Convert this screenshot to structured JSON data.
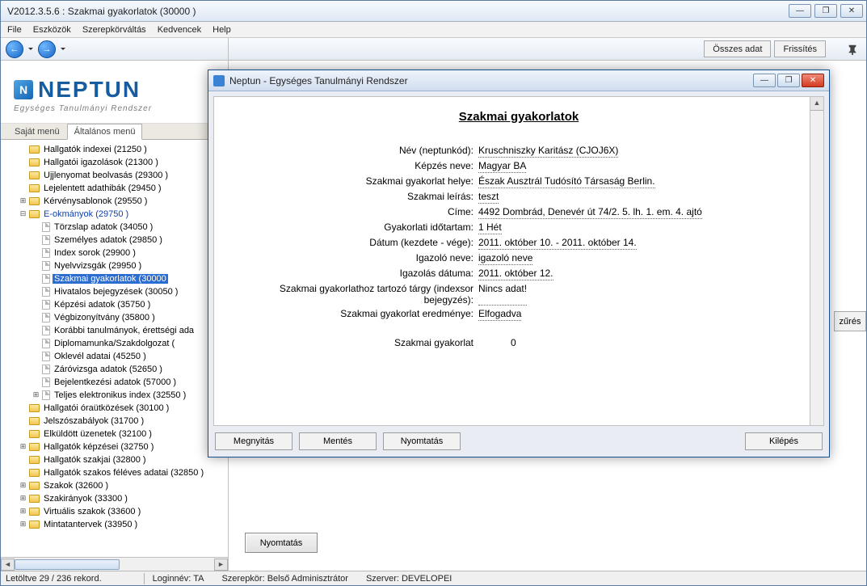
{
  "window": {
    "title": "V2012.3.5.6 : Szakmai gyakorlatok (30000  )"
  },
  "menu": {
    "file": "File",
    "tools": "Eszközök",
    "role": "Szerepkörváltás",
    "fav": "Kedvencek",
    "help": "Help"
  },
  "logo": {
    "name": "NEPTUN",
    "sub": "Egységes Tanulmányi Rendszer",
    "mark": "N"
  },
  "tabs": {
    "own": "Saját menü",
    "general": "Általános menü"
  },
  "toolbar": {
    "all": "Összes adat",
    "refresh": "Frissítés",
    "filter": "zűrés"
  },
  "tree": [
    {
      "d": 1,
      "exp": "",
      "ic": "folder",
      "txt": "Hallgatók indexei (21250  )"
    },
    {
      "d": 1,
      "exp": "",
      "ic": "folder",
      "txt": "Hallgatói igazolások (21300  )"
    },
    {
      "d": 1,
      "exp": "",
      "ic": "folder",
      "txt": "Ujjlenyomat beolvasás (29300  )"
    },
    {
      "d": 1,
      "exp": "",
      "ic": "folder",
      "txt": "Lejelentett adathibák (29450  )"
    },
    {
      "d": 1,
      "exp": "+",
      "ic": "folder",
      "txt": "Kérvénysablonok (29550  )"
    },
    {
      "d": 1,
      "exp": "-",
      "ic": "folder",
      "txt": "E-okmányok (29750  )",
      "cur": true
    },
    {
      "d": 2,
      "exp": "",
      "ic": "page",
      "txt": "Törzslap adatok (34050  )"
    },
    {
      "d": 2,
      "exp": "",
      "ic": "page",
      "txt": "Személyes adatok (29850  )"
    },
    {
      "d": 2,
      "exp": "",
      "ic": "page",
      "txt": "Index sorok (29900  )"
    },
    {
      "d": 2,
      "exp": "",
      "ic": "page",
      "txt": "Nyelvvizsgák (29950  )"
    },
    {
      "d": 2,
      "exp": "",
      "ic": "page",
      "txt": "Szakmai gyakorlatok (30000",
      "sel": true
    },
    {
      "d": 2,
      "exp": "",
      "ic": "page",
      "txt": "Hivatalos bejegyzések (30050  )"
    },
    {
      "d": 2,
      "exp": "",
      "ic": "page",
      "txt": "Képzési adatok (35750  )"
    },
    {
      "d": 2,
      "exp": "",
      "ic": "page",
      "txt": "Végbizonyítvány (35800  )"
    },
    {
      "d": 2,
      "exp": "",
      "ic": "page",
      "txt": "Korábbi tanulmányok, érettségi ada"
    },
    {
      "d": 2,
      "exp": "",
      "ic": "page",
      "txt": "Diplomamunka/Szakdolgozat ("
    },
    {
      "d": 2,
      "exp": "",
      "ic": "page",
      "txt": "Oklevél adatai (45250  )"
    },
    {
      "d": 2,
      "exp": "",
      "ic": "page",
      "txt": "Záróvizsga adatok (52650  )"
    },
    {
      "d": 2,
      "exp": "",
      "ic": "page",
      "txt": "Bejelentkezési adatok (57000  )"
    },
    {
      "d": 2,
      "exp": "+",
      "ic": "page",
      "txt": "Teljes elektronikus index (32550  )"
    },
    {
      "d": 1,
      "exp": "",
      "ic": "folder",
      "txt": "Hallgatói óraütközések (30100  )"
    },
    {
      "d": 1,
      "exp": "",
      "ic": "folder",
      "txt": "Jelszószabályok (31700  )"
    },
    {
      "d": 1,
      "exp": "",
      "ic": "folder",
      "txt": "Elküldött üzenetek (32100  )"
    },
    {
      "d": 1,
      "exp": "+",
      "ic": "folder",
      "txt": "Hallgatók képzései (32750  )"
    },
    {
      "d": 1,
      "exp": "",
      "ic": "folder",
      "txt": "Hallgatók szakjai (32800  )"
    },
    {
      "d": 1,
      "exp": "",
      "ic": "folder",
      "txt": "Hallgatók szakos féléves adatai (32850  )"
    },
    {
      "d": 1,
      "exp": "+",
      "ic": "folder",
      "txt": "Szakok (32600  )"
    },
    {
      "d": 1,
      "exp": "+",
      "ic": "folder",
      "txt": "Szakirányok (33300  )"
    },
    {
      "d": 1,
      "exp": "+",
      "ic": "folder",
      "txt": "Virtuális szakok (33600  )"
    },
    {
      "d": 1,
      "exp": "+",
      "ic": "folder",
      "txt": "Mintatantervek (33950  )"
    }
  ],
  "bottom": {
    "print": "Nyomtatás"
  },
  "status": {
    "records": "Letöltve 29 / 236 rekord.",
    "login": "Loginnév: TA",
    "role": "Szerepkör: Belső Adminisztrátor",
    "server": "Szerver: DEVELOPEI"
  },
  "modal": {
    "title": "Neptun - Egységes Tanulmányi Rendszer",
    "heading": "Szakmai gyakorlatok",
    "fields": [
      {
        "lab": "Név (neptunkód):",
        "val": "Kruschniszky Karitász (CJOJ6X)"
      },
      {
        "lab": "Képzés neve:",
        "val": "Magyar BA"
      },
      {
        "lab": "Szakmai gyakorlat helye:",
        "val": "Észak Ausztrál Tudósító Társaság Berlin."
      },
      {
        "lab": "Szakmai leírás:",
        "val": "teszt"
      },
      {
        "lab": "Címe:",
        "val": "4492 Dombrád, Denevér út 74/2. 5. lh. 1. em. 4. ajtó"
      },
      {
        "lab": "Gyakorlati időtartam:",
        "val": "1 Hét"
      },
      {
        "lab": "Dátum (kezdete - vége):",
        "val": "2011. október 10. - 2011. október 14."
      },
      {
        "lab": "Igazoló neve:",
        "val": "igazoló neve"
      },
      {
        "lab": "Igazolás dátuma:",
        "val": "2011. október 12."
      },
      {
        "lab": "Szakmai gyakorlathoz tartozó tárgy (indexsor bejegyzés):",
        "val": "Nincs adat!"
      },
      {
        "lab": "Szakmai gyakorlat eredménye:",
        "val": "Elfogadva"
      }
    ],
    "summary": {
      "lab": "Szakmai gyakorlat",
      "val": "0"
    },
    "buttons": {
      "open": "Megnyitás",
      "save": "Mentés",
      "print": "Nyomtatás",
      "exit": "Kilépés"
    }
  }
}
